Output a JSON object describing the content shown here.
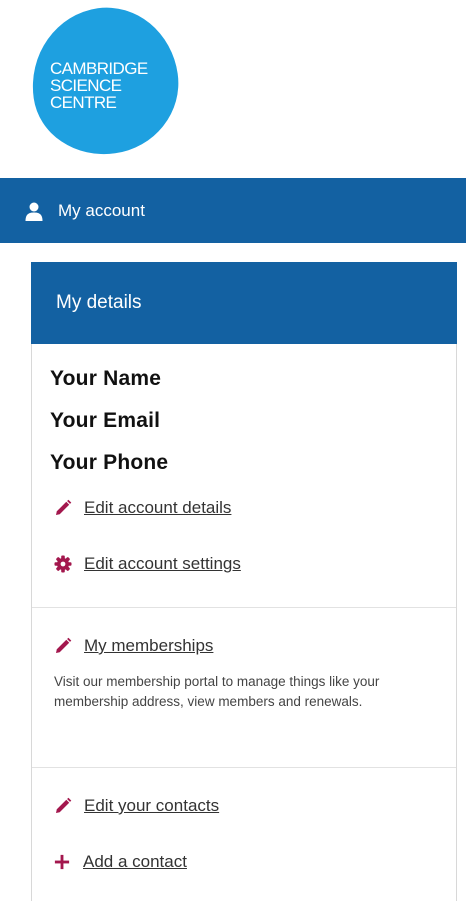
{
  "logo": {
    "lines": [
      "CAMBRIDGE",
      "SCIENCE",
      "CENTRE"
    ],
    "color": "#1ea0e0"
  },
  "account_bar": {
    "label": "My account",
    "icon": "user-icon",
    "color": "#1361a2"
  },
  "panel": {
    "title": "My details",
    "details": {
      "name": "Your Name",
      "email": "Your Email",
      "phone": "Your Phone",
      "edit_details": {
        "label": "Edit account details",
        "icon": "pencil-icon"
      },
      "edit_settings": {
        "label": "Edit account settings",
        "icon": "gear-icon"
      }
    },
    "memberships": {
      "label": "My memberships",
      "icon": "pencil-icon",
      "description": "Visit our membership portal to manage things like your membership address, view members and renewals."
    },
    "contacts": {
      "edit": {
        "label": "Edit your contacts",
        "icon": "pencil-icon"
      },
      "add": {
        "label": "Add a contact",
        "icon": "plus-icon"
      }
    }
  },
  "colors": {
    "accent": "#1361a2",
    "icon": "#a3174d",
    "logo": "#1ea0e0"
  }
}
